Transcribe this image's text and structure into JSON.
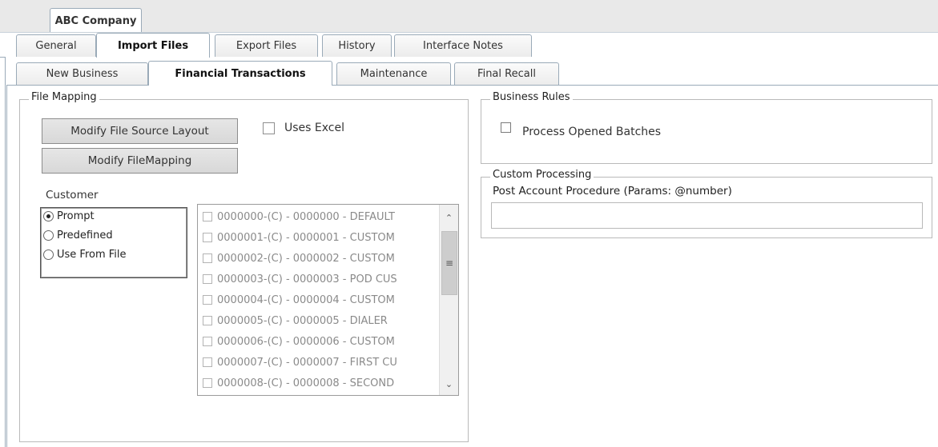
{
  "company_tab": "ABC Company",
  "top_tabs": [
    "General",
    "Import Files",
    "Export Files",
    "History",
    "Interface Notes"
  ],
  "sub_tabs": [
    "New Business",
    "Financial Transactions",
    "Maintenance",
    "Final Recall"
  ],
  "file_mapping": {
    "legend": "File Mapping",
    "modify_source_layout": "Modify File Source Layout",
    "modify_file_mapping": "Modify FileMapping",
    "uses_excel": "Uses Excel",
    "customer_label": "Customer",
    "customer_options": [
      "Prompt",
      "Predefined",
      "Use From File"
    ],
    "customer_selected": "Prompt",
    "customers": [
      "0000000-(C) - 0000000 - DEFAULT",
      "0000001-(C) - 0000001 - CUSTOM",
      "0000002-(C) - 0000002 - CUSTOM",
      "0000003-(C) - 0000003 - POD CUS",
      "0000004-(C) - 0000004 - CUSTOM",
      "0000005-(C) - 0000005 - DIALER",
      "0000006-(C) - 0000006 - CUSTOM",
      "0000007-(C) - 0000007 - FIRST CU",
      "0000008-(C) - 0000008 - SECOND"
    ]
  },
  "business_rules": {
    "legend": "Business Rules",
    "process_opened_batches": "Process Opened Batches"
  },
  "custom_processing": {
    "legend": "Custom Processing",
    "post_account_label": "Post Account Procedure (Params: @number)",
    "post_account_value": ""
  },
  "icons": {
    "scroll_up": "scroll-up-arrow",
    "scroll_down": "scroll-down-arrow",
    "scroll_grip": "scroll-grip"
  }
}
